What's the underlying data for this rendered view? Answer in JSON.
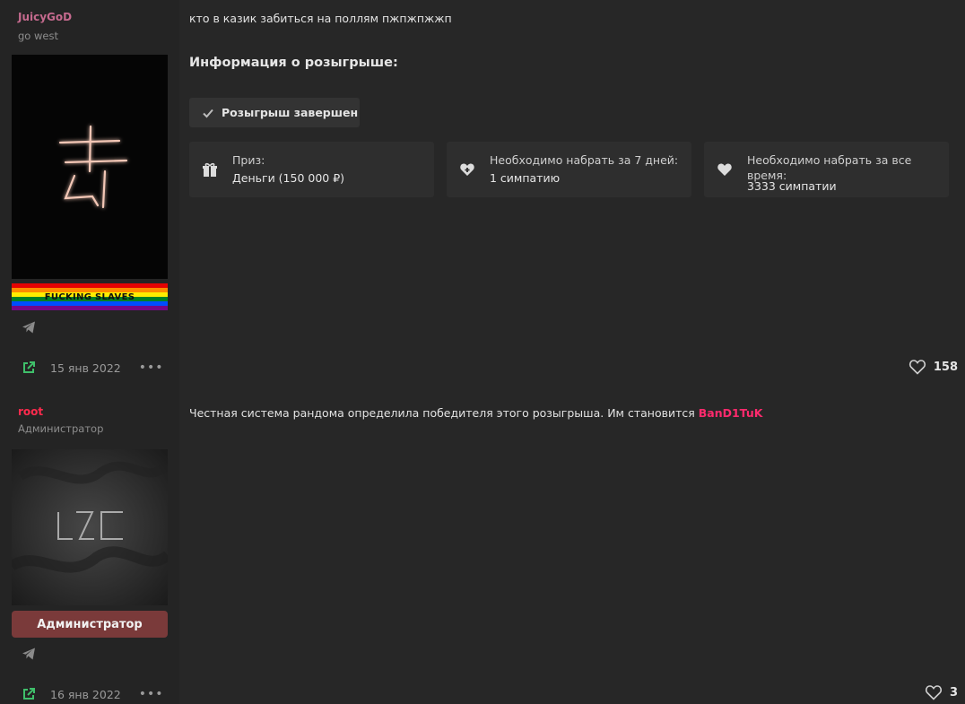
{
  "posts": [
    {
      "username": "JuicyGoD",
      "username_color": "#c56a8e",
      "user_title": "go west",
      "banner": "FUCKING SLAVES",
      "date": "15 янв 2022",
      "message": "кто в казик забиться на поллям пжпжпжжп",
      "likes": "158",
      "giveaway": {
        "title": "Информация о розыгрыше:",
        "status": "Розыгрыш завершен",
        "cards": [
          {
            "icon": "gift-icon",
            "label": "Приз:",
            "value": "Деньги (150 000 ₽)"
          },
          {
            "icon": "heart-plus-icon",
            "label": "Необходимо набрать за 7 дней:",
            "value": "1 симпатию"
          },
          {
            "icon": "heart-icon",
            "label": "Необходимо набрать за все время:",
            "value": "3333 симпатии"
          }
        ]
      }
    },
    {
      "username": "root",
      "username_color": "#ff2a4d",
      "user_title": "Администратор",
      "banner": "Администратор",
      "date": "16 янв 2022",
      "message_prefix": "Честная система рандома определила победителя этого розыгрыша. Им становится",
      "winner": "BanD1TuK",
      "likes": "3"
    }
  ],
  "colors": {
    "accent_green": "#3fbf6a",
    "winner": "#ff2a6d"
  }
}
